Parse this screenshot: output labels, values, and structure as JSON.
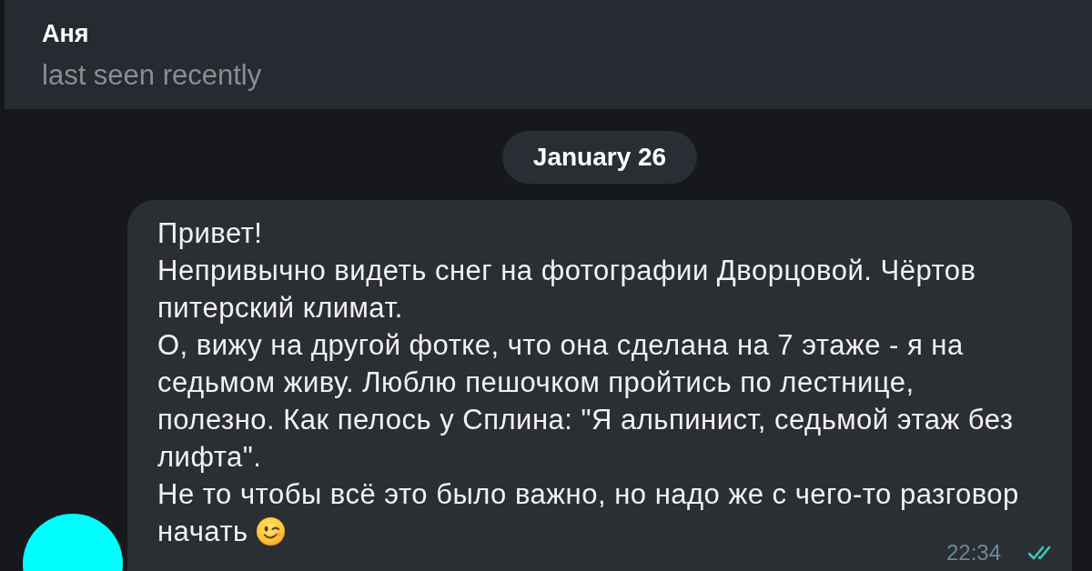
{
  "header": {
    "name": "Аня",
    "status": "last seen recently"
  },
  "date_badge": "January 26",
  "messages": [
    {
      "paragraphs": [
        "Привет!",
        "Непривычно видеть снег на фотографии Дворцовой. Чёртов питерский климат.",
        "О, вижу на другой фотке, что она сделана на 7 этаже - я на седьмом живу. Люблю пешочком пройтись по лестнице, полезно. Как пелось у Сплина: \"Я альпинист, седьмой этаж без лифта\".",
        "Не то чтобы всё это было важно, но надо же с чего-то разговор начать"
      ],
      "time": "22:34",
      "read": true
    }
  ]
}
